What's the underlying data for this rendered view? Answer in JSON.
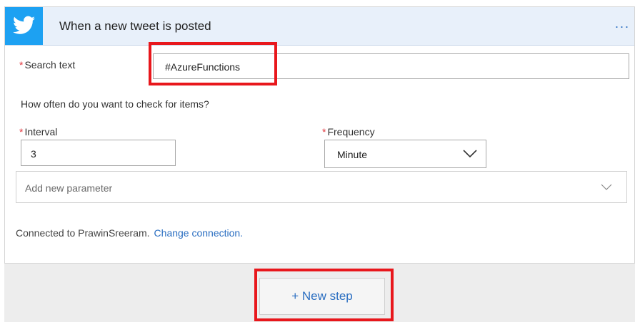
{
  "trigger": {
    "title": "When a new tweet is posted",
    "more_label": "...",
    "icon": "twitter-bird-icon",
    "brand_color": "#1da1f2"
  },
  "search": {
    "required_mark": "*",
    "label": "Search text",
    "value": "#AzureFunctions"
  },
  "schedule": {
    "question": "How often do you want to check for items?",
    "interval_label": "Interval",
    "interval_value": "3",
    "frequency_label": "Frequency",
    "frequency_value": "Minute"
  },
  "parameters": {
    "placeholder": "Add new parameter"
  },
  "connection": {
    "text": "Connected to PrawinSreeram.",
    "change_link": "Change connection."
  },
  "actions": {
    "new_step_label": "+ New step"
  },
  "colors": {
    "accent": "#2a6ec1",
    "required": "#e0343b",
    "highlight": "#e8171c",
    "header_bg": "#e8f0fa"
  }
}
